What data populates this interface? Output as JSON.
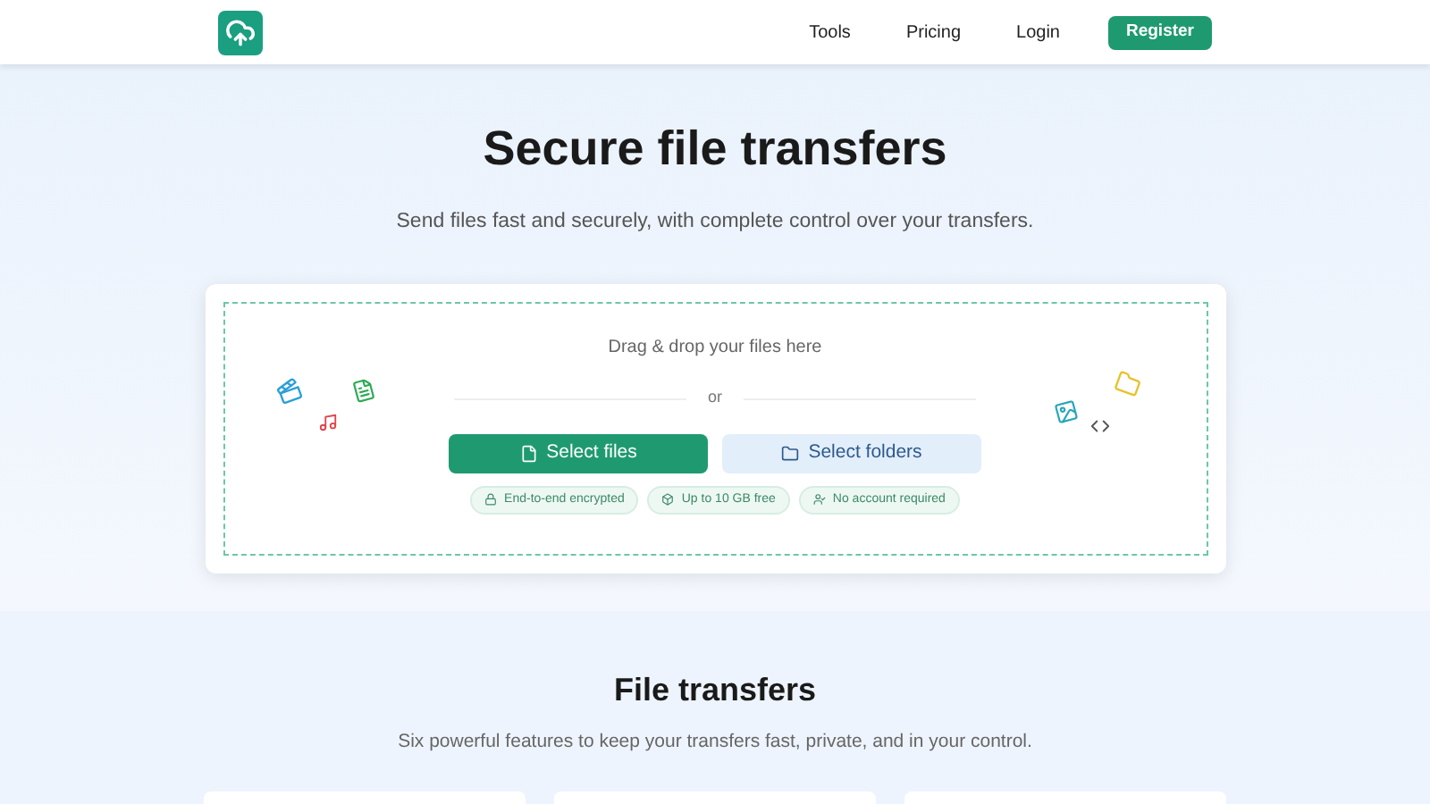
{
  "nav": {
    "links": [
      {
        "label": "Tools"
      },
      {
        "label": "Pricing"
      },
      {
        "label": "Login"
      }
    ],
    "cta": "Register"
  },
  "hero": {
    "title": "Secure file transfers",
    "subtitle": "Send files fast and securely, with complete control over your transfers."
  },
  "dropzone": {
    "prompt": "Drag & drop your files here",
    "separator": "or",
    "buttons": [
      {
        "label": "Select files",
        "kind": "primary"
      },
      {
        "label": "Select folders",
        "kind": "secondary"
      }
    ],
    "badges": [
      {
        "label": "End-to-end encrypted",
        "kind": "lock"
      },
      {
        "label": "Up to 10 GB free",
        "kind": "box"
      },
      {
        "label": "No account required",
        "kind": "user"
      }
    ]
  },
  "features": {
    "title": "File transfers",
    "subtitle": "Six powerful features to keep your transfers fast, private, and in your control."
  }
}
